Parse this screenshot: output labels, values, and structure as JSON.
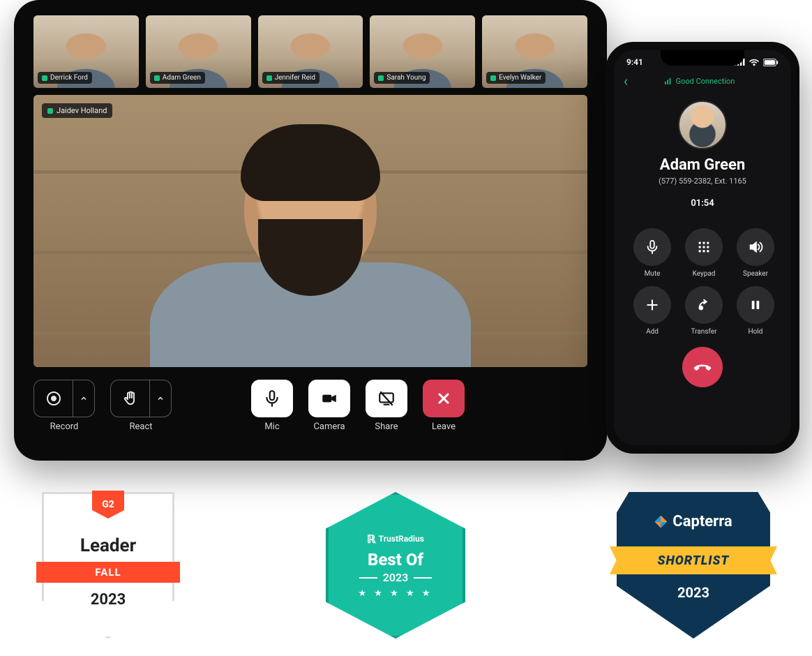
{
  "tablet": {
    "participants": [
      {
        "name": "Derrick Ford"
      },
      {
        "name": "Adam Green"
      },
      {
        "name": "Jennifer Reid"
      },
      {
        "name": "Sarah Young"
      },
      {
        "name": "Evelyn Walker"
      }
    ],
    "activeSpeaker": {
      "name": "Jaidev Holland"
    },
    "controls": {
      "record": "Record",
      "react": "React",
      "mic": "Mic",
      "camera": "Camera",
      "share": "Share",
      "leave": "Leave"
    }
  },
  "phone": {
    "status": {
      "time": "9:41"
    },
    "connection": "Good Connection",
    "caller": {
      "name": "Adam Green",
      "number": "(577) 559-2382, Ext. 1165",
      "duration": "01:54"
    },
    "pad": {
      "mute": "Mute",
      "keypad": "Keypad",
      "speaker": "Speaker",
      "add": "Add",
      "transfer": "Transfer",
      "hold": "Hold"
    }
  },
  "badges": {
    "g2": {
      "brand": "G2",
      "title": "Leader",
      "season": "FALL",
      "year": "2023"
    },
    "trustradius": {
      "brand": "TrustRadius",
      "title": "Best Of",
      "year": "2023"
    },
    "capterra": {
      "brand": "Capterra",
      "title": "SHORTLIST",
      "year": "2023"
    }
  }
}
